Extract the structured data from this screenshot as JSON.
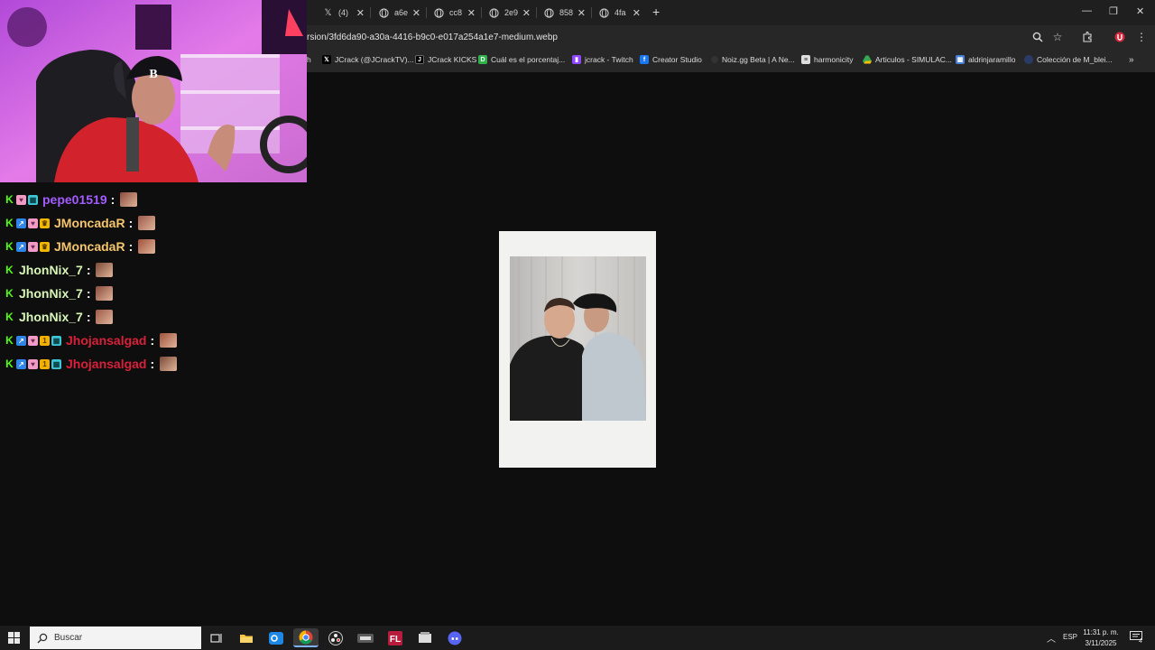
{
  "tabs": [
    {
      "label": "(4)",
      "icon": "x-logo-icon"
    },
    {
      "label": "a6e",
      "icon": "globe-icon"
    },
    {
      "label": "cc8",
      "icon": "globe-icon"
    },
    {
      "label": "2e9",
      "icon": "globe-icon"
    },
    {
      "label": "858",
      "icon": "globe-icon"
    },
    {
      "label": "4fa",
      "icon": "globe-icon"
    }
  ],
  "address_bar": {
    "url": "rsion/3fd6da90-a30a-4416-b9c0-e017a254a1e7-medium.webp"
  },
  "bookmarks": [
    {
      "label": "h",
      "icon": "twitch-icon"
    },
    {
      "label": "JCrack (@JCrackTV)...",
      "icon": "x-logo-icon",
      "color": "#000000"
    },
    {
      "label": "JCrack KICKS",
      "icon": "kick-icon",
      "color": "#000000"
    },
    {
      "label": "Cuál es el porcentaj...",
      "icon": "doc-icon",
      "color": "#2fb24c"
    },
    {
      "label": "jcrack - Twitch",
      "icon": "twitch-icon",
      "color": "#9146ff"
    },
    {
      "label": "Creator Studio",
      "icon": "facebook-icon",
      "color": "#1877f2"
    },
    {
      "label": "Noiz.gg Beta | A Ne...",
      "icon": "noiz-icon",
      "color": "#333333"
    },
    {
      "label": "harmonicity",
      "icon": "page-icon",
      "color": "#dddddd"
    },
    {
      "label": "Articulos - SIMULAC...",
      "icon": "drive-icon",
      "color": "#34a853"
    },
    {
      "label": "aldrinjaramillo",
      "icon": "site-icon",
      "color": "#4a7fd6"
    },
    {
      "label": "Colección de M_blei...",
      "icon": "globe-icon",
      "color": "#2a3b66"
    }
  ],
  "chat": [
    {
      "user": "pepe01519",
      "color": "#a35cff",
      "badges": [
        "kick-badge",
        "sub-badge",
        "gift-badge"
      ]
    },
    {
      "user": "JMoncadaR",
      "color": "#f5c56c",
      "badges": [
        "kick-badge",
        "arrow-badge",
        "sub-badge",
        "crown-badge"
      ]
    },
    {
      "user": "JMoncadaR",
      "color": "#f5c56c",
      "badges": [
        "kick-badge",
        "arrow-badge",
        "sub-badge",
        "crown-badge"
      ]
    },
    {
      "user": "JhonNix_7",
      "color": "#d8f5b8",
      "badges": [
        "kick-badge"
      ]
    },
    {
      "user": "JhonNix_7",
      "color": "#d8f5b8",
      "badges": [
        "kick-badge"
      ]
    },
    {
      "user": "JhonNix_7",
      "color": "#d8f5b8",
      "badges": [
        "kick-badge"
      ]
    },
    {
      "user": "Jhojansalgad",
      "color": "#d9203a",
      "badges": [
        "kick-badge",
        "arrow-badge",
        "sub-badge",
        "one-badge",
        "gift-badge"
      ]
    },
    {
      "user": "Jhojansalgad",
      "color": "#d9203a",
      "badges": [
        "kick-badge",
        "arrow-badge",
        "sub-badge",
        "one-badge",
        "gift-badge"
      ]
    }
  ],
  "chat_colon": ":",
  "taskbar": {
    "search_placeholder": "Buscar",
    "language": "ESP",
    "time": "11:31 p. m.",
    "date": "3/11/2025",
    "notification_count": "4"
  }
}
